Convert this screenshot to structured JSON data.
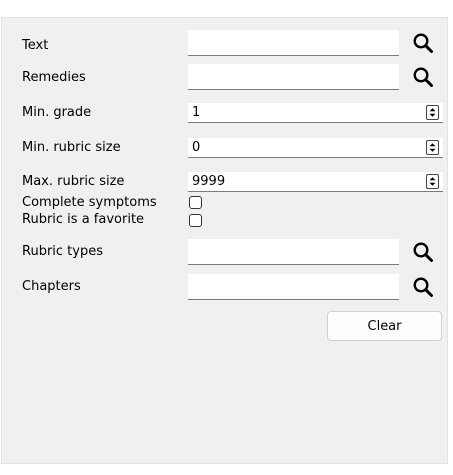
{
  "form": {
    "text_label": "Text",
    "text_value": "",
    "remedies_label": "Remedies",
    "remedies_value": "",
    "min_grade_label": "Min. grade",
    "min_grade_value": "1",
    "min_rubric_size_label": "Min. rubric size",
    "min_rubric_size_value": "0",
    "max_rubric_size_label": "Max. rubric size",
    "max_rubric_size_value": "9999",
    "complete_symptoms_label": "Complete symptoms",
    "complete_symptoms_checked": false,
    "rubric_favorite_label": "Rubric is a favorite",
    "rubric_favorite_checked": false,
    "rubric_types_label": "Rubric types",
    "rubric_types_value": "",
    "chapters_label": "Chapters",
    "chapters_value": "",
    "clear_label": "Clear"
  },
  "icons": {
    "search": "search-icon",
    "spin": "spin-arrows-icon"
  }
}
